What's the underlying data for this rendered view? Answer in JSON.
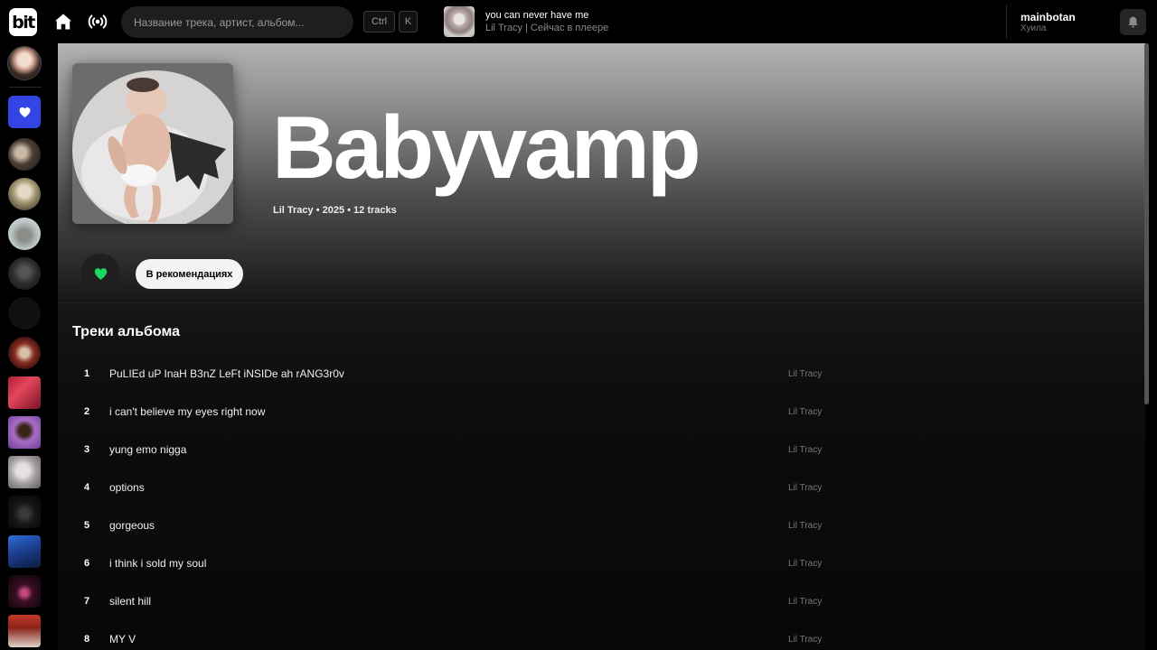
{
  "app": {
    "logo_text": "bit"
  },
  "topbar": {
    "search_placeholder": "Название трека, артист, альбом...",
    "shortcut_keys": [
      "Ctrl",
      "K"
    ],
    "now_playing": {
      "title": "you can never have me",
      "subtitle": "Lil Tracy | Сейчас в плеере"
    },
    "user": {
      "name": "mainbotan",
      "status": "Хуила"
    },
    "icons": [
      "home-icon",
      "radio-icon",
      "bell-icon"
    ]
  },
  "sidebar": {
    "icons": [
      "heart-icon"
    ]
  },
  "album": {
    "title": "Babyvamp",
    "meta": "Lil Tracy • 2025 • 12 tracks",
    "recommend_label": "В рекомендациях",
    "tracks_heading": "Треки альбома",
    "tracks": [
      {
        "number": "1",
        "title": "PuLIEd uP InaH B3nZ LeFt iNSIDe ah rANG3r0v",
        "artist": "Lil Tracy"
      },
      {
        "number": "2",
        "title": "i can't believe my eyes right now",
        "artist": "Lil Tracy"
      },
      {
        "number": "3",
        "title": "yung emo nigga",
        "artist": "Lil Tracy"
      },
      {
        "number": "4",
        "title": "options",
        "artist": "Lil Tracy"
      },
      {
        "number": "5",
        "title": "gorgeous",
        "artist": "Lil Tracy"
      },
      {
        "number": "6",
        "title": "i think i sold my soul",
        "artist": "Lil Tracy"
      },
      {
        "number": "7",
        "title": "silent hill",
        "artist": "Lil Tracy"
      },
      {
        "number": "8",
        "title": "MY V",
        "artist": "Lil Tracy"
      }
    ]
  },
  "colors": {
    "accent_blue": "#3445e6",
    "like_green": "#1ed760"
  }
}
